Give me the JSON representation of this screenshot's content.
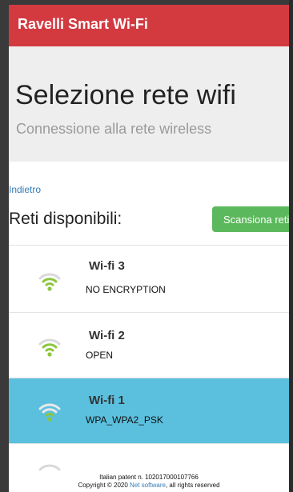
{
  "header": {
    "title": "Ravelli Smart Wi-Fi"
  },
  "jumbotron": {
    "heading": "Selezione rete wifi",
    "subheading": "Connessione alla rete wireless"
  },
  "back_link": "Indietro",
  "networks_section": {
    "title": "Reti disponibili:",
    "scan_button": "Scansiona reti"
  },
  "networks": [
    {
      "ssid": "Wi-fi 3",
      "security": "NO ENCRYPTION",
      "selected": false,
      "signal_bars": 3
    },
    {
      "ssid": "Wi-fi 2",
      "security": "OPEN",
      "selected": false,
      "signal_bars": 3
    },
    {
      "ssid": "Wi-fi 1",
      "security": "WPA_WPA2_PSK",
      "selected": true,
      "signal_bars": 3
    }
  ],
  "footer": {
    "patent": "Italian patent n. 102017000107766",
    "copyright_prefix": "Copyright © 2020 ",
    "company": "Net software",
    "copyright_suffix": ", all rights reserved"
  },
  "colors": {
    "brand_red": "#d33a40",
    "selected_row": "#5bc0de",
    "scan_button": "#5cb85c",
    "signal_active": "#8cc63f",
    "signal_inactive": "#d9d9d9",
    "link": "#337ab7"
  }
}
